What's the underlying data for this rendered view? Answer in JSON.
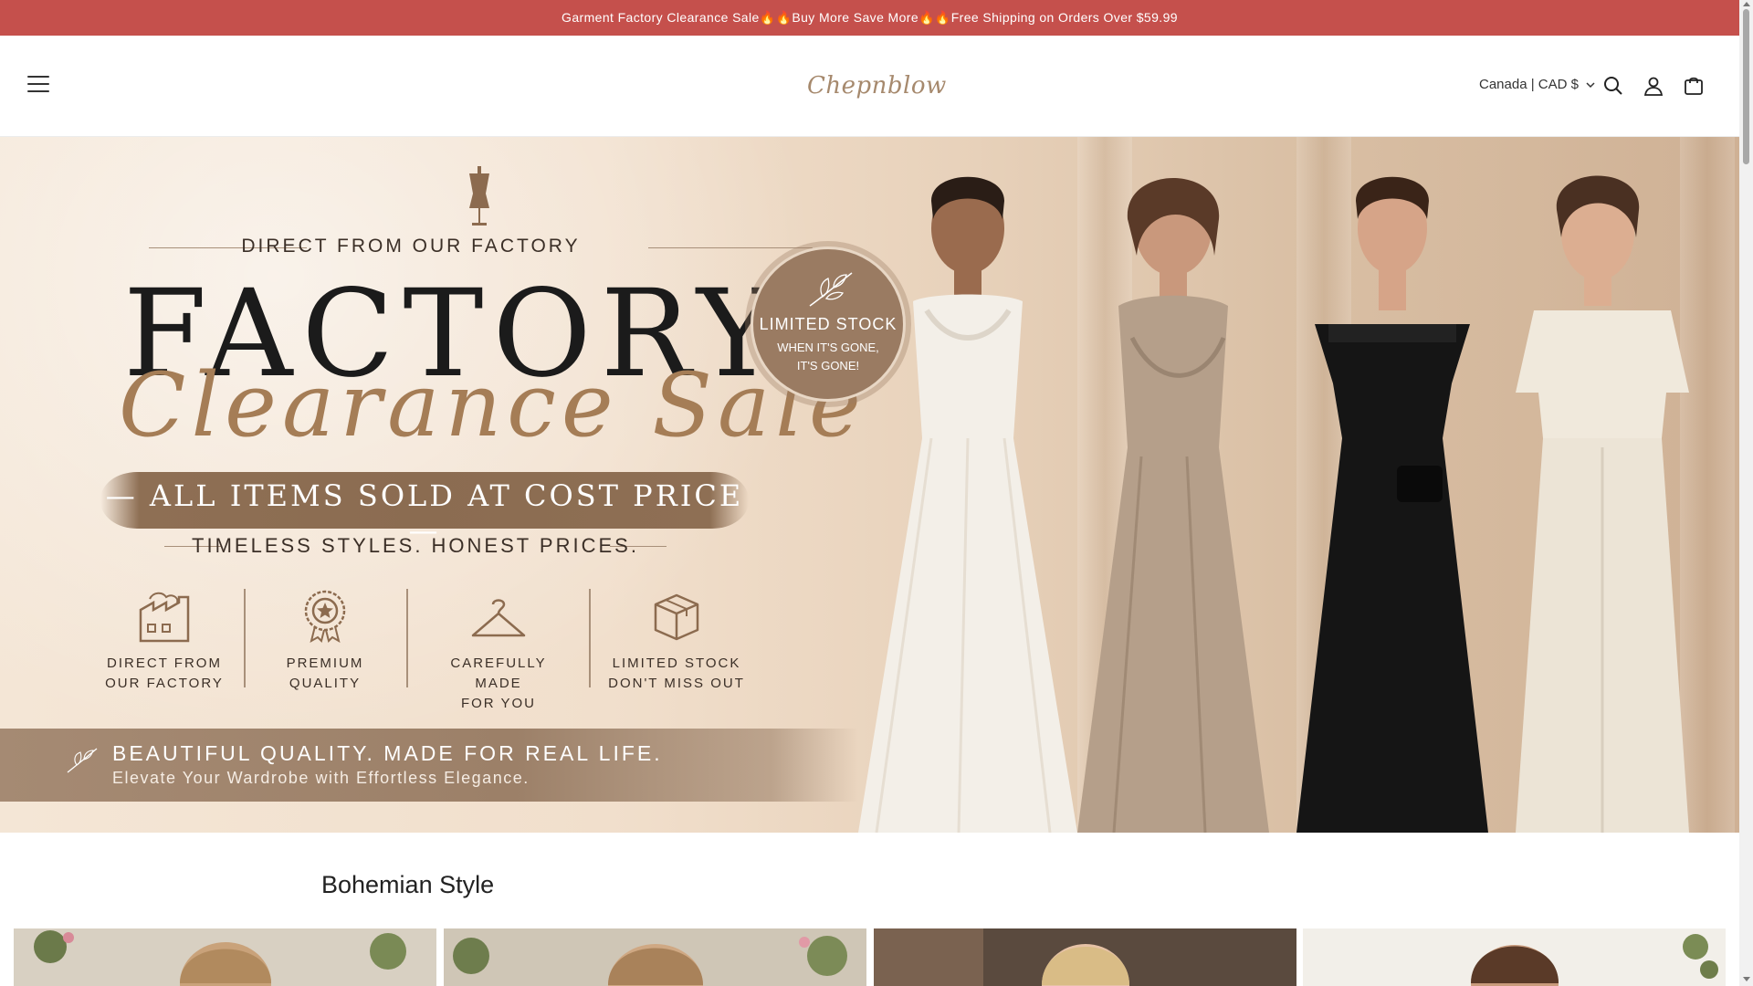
{
  "announcement": {
    "text": "Garment Factory Clearance Sale🔥🔥Buy More Save More🔥🔥Free Shipping on Orders Over $59.99"
  },
  "header": {
    "logo_text": "Chepnblow",
    "currency_label": "Canada | CAD $",
    "icons": [
      "menu-icon",
      "search-icon",
      "account-icon",
      "cart-icon"
    ]
  },
  "hero": {
    "kicker": "DIRECT FROM OUR FACTORY",
    "title": "FACTORY",
    "script": "Clearance Sale",
    "badge_main": "LIMITED STOCK",
    "badge_sub1": "WHEN IT'S GONE,",
    "badge_sub2": "IT'S GONE!",
    "banner_text": "— ALL ITEMS SOLD AT COST PRICE —",
    "tagline": "TIMELESS STYLES. HONEST PRICES.",
    "features": [
      {
        "line1": "DIRECT FROM",
        "line2": "OUR FACTORY",
        "icon": "factory-icon"
      },
      {
        "line1": "PREMIUM",
        "line2": "QUALITY",
        "icon": "award-icon"
      },
      {
        "line1": "CAREFULLY MADE",
        "line2": "FOR YOU",
        "icon": "hanger-icon"
      },
      {
        "line1": "LIMITED STOCK",
        "line2": "DON'T MISS OUT",
        "icon": "box-icon"
      }
    ],
    "band_title": "BEAUTIFUL QUALITY. MADE FOR REAL LIFE.",
    "band_sub": "Elevate Your Wardrobe with Effortless Elegance."
  },
  "collection": {
    "title": "Bohemian Style"
  },
  "colors": {
    "announcement_bg": "#c5504c",
    "accent_gold": "#a57d56",
    "band_brown": "#9c8068"
  }
}
